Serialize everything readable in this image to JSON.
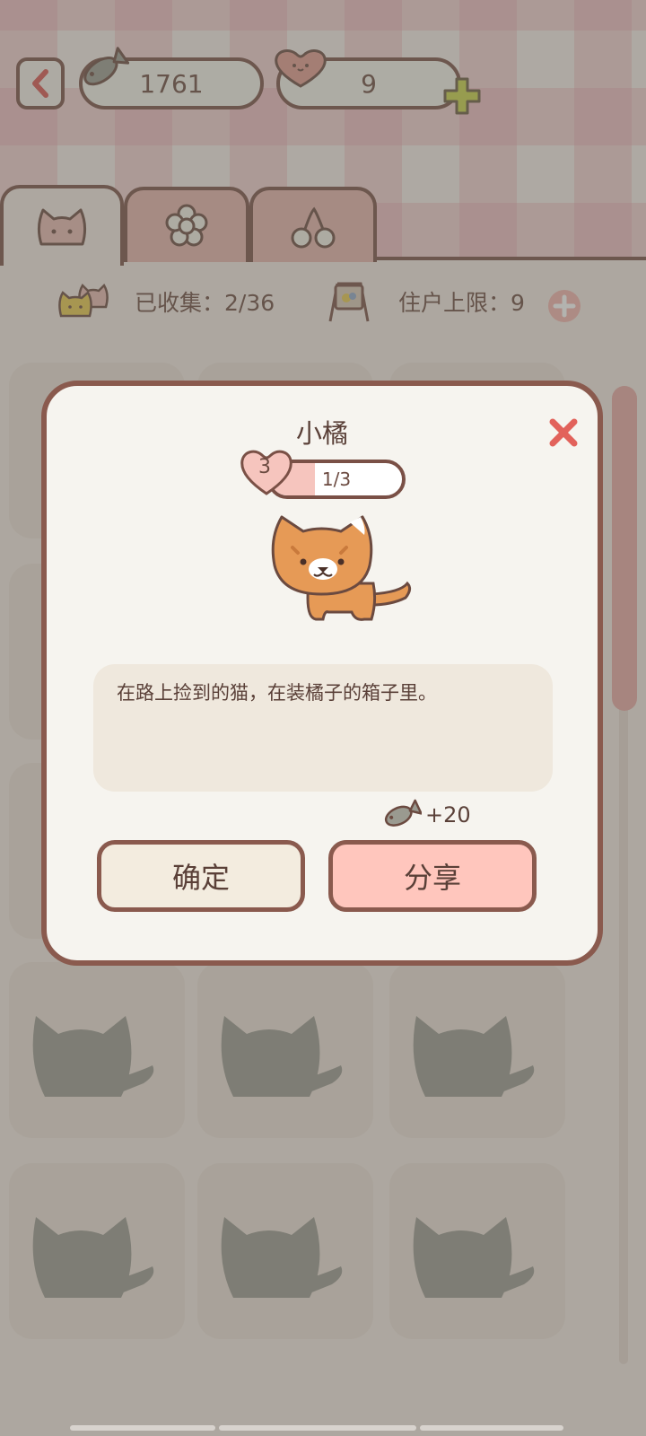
{
  "header": {
    "fish_count": "1761",
    "heart_count": "9"
  },
  "tabs": [
    {
      "icon": "cat-face-icon",
      "active": true
    },
    {
      "icon": "flower-icon",
      "active": false
    },
    {
      "icon": "cherry-icon",
      "active": false
    }
  ],
  "stats": {
    "collected": "已收集：2/36",
    "resident_limit": "住户上限：9"
  },
  "modal": {
    "title": "小橘",
    "level": "3",
    "progress_text": "1/3",
    "progress_fraction": 0.3333,
    "description": "在路上捡到的猫，在装橘子的箱子里。",
    "reward": "+20",
    "confirm_label": "确定",
    "share_label": "分享"
  },
  "colors": {
    "accent_border": "#7a5046",
    "share_button": "#ffc6bd",
    "confirm_button": "#f3ecdf",
    "plus_green": "#c9d447",
    "close_red": "#e2625b"
  }
}
